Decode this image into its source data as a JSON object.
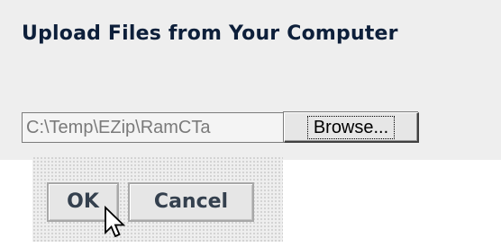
{
  "dialog": {
    "title": "Upload Files from Your Computer"
  },
  "file_input": {
    "value": "C:\\Temp\\EZip\\RamCTa",
    "browse_label": "Browse..."
  },
  "actions": {
    "ok_label": "OK",
    "cancel_label": "Cancel"
  },
  "icons": {
    "cursor": "arrow-pointer-icon"
  },
  "colors": {
    "title": "#0d1f3a",
    "button_text": "#34404e",
    "panel_background": "#eeeeee"
  }
}
